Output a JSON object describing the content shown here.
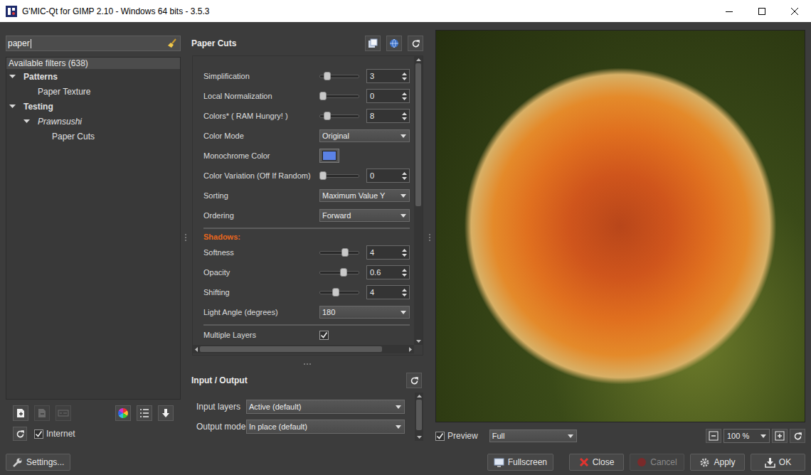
{
  "window": {
    "title": "G'MIC-Qt for GIMP 2.10 - Windows 64 bits - 3.5.3"
  },
  "search": {
    "value": "paper"
  },
  "filters": {
    "header": "Available filters (638)",
    "tree": [
      {
        "label": "Patterns",
        "kind": "category",
        "depth": 0,
        "expanded": true,
        "selected": false
      },
      {
        "label": "Paper Texture",
        "kind": "filter",
        "depth": 1,
        "expanded": false,
        "selected": false
      },
      {
        "label": "Testing",
        "kind": "category",
        "depth": 0,
        "expanded": true,
        "selected": false
      },
      {
        "label": "Prawnsushi",
        "kind": "subcategory",
        "depth": 1,
        "expanded": true,
        "selected": false
      },
      {
        "label": "Paper Cuts",
        "kind": "filter",
        "depth": 2,
        "expanded": false,
        "selected": false
      }
    ]
  },
  "filter_tools": [
    {
      "kind": "add-favorite",
      "disabled": false
    },
    {
      "kind": "remove-favorite",
      "disabled": true
    },
    {
      "kind": "rename-favorite",
      "disabled": true
    },
    {
      "kind": "colors",
      "disabled": false
    },
    {
      "kind": "list",
      "disabled": false
    },
    {
      "kind": "download",
      "disabled": false
    }
  ],
  "internet": {
    "label": "Internet",
    "checked": true
  },
  "filter": {
    "title": "Paper Cuts",
    "params": [
      {
        "kind": "slider",
        "label": "Simplification",
        "level": 0.12,
        "value": "3"
      },
      {
        "kind": "slider",
        "label": "Local Normalization",
        "level": 0,
        "value": "0"
      },
      {
        "kind": "slider",
        "label": "Colors* ( RAM Hungry! )",
        "level": 0.14,
        "value": "8"
      },
      {
        "kind": "dropdown",
        "label": "Color Mode",
        "value": "Original"
      },
      {
        "kind": "color",
        "label": "Monochrome Color",
        "color": "#5b82e6"
      },
      {
        "kind": "slider",
        "label": "Color Variation (Off If Random)",
        "level": 0,
        "value": "0"
      },
      {
        "kind": "dropdown",
        "label": "Sorting",
        "value": "Maximum Value Y"
      },
      {
        "kind": "dropdown",
        "label": "Ordering",
        "value": "Forward"
      },
      {
        "kind": "separator"
      },
      {
        "kind": "heading",
        "label": "Shadows:"
      },
      {
        "kind": "slider",
        "label": "Softness",
        "level": 0.67,
        "value": "4"
      },
      {
        "kind": "slider",
        "label": "Opacity",
        "level": 0.62,
        "value": "0.6"
      },
      {
        "kind": "slider",
        "label": "Shifting",
        "level": 0.4,
        "value": "4"
      },
      {
        "kind": "dropdown",
        "label": "Light Angle (degrees)",
        "value": "180"
      },
      {
        "kind": "separator"
      },
      {
        "kind": "checkbox",
        "label": "Multiple Layers",
        "checked": true
      }
    ],
    "scroll": {
      "vertical": {
        "level": 0.52
      },
      "horizontal": {
        "level": 0.88
      }
    }
  },
  "io": {
    "title": "Input / Output",
    "fields": [
      {
        "label": "Input layers",
        "value": "Active (default)"
      },
      {
        "label": "Output mode",
        "value": "In place (default)"
      }
    ],
    "scroll": {
      "level": 0.9
    }
  },
  "preview": {
    "label": "Preview",
    "checked": true,
    "mode": "Full",
    "zoom": "100 %"
  },
  "settings": {
    "label": "Settings..."
  },
  "buttons": [
    {
      "label": "Fullscreen",
      "kind": "fullscreen",
      "disabled": false
    },
    {
      "label": "Close",
      "kind": "close",
      "disabled": false
    },
    {
      "label": "Cancel",
      "kind": "cancel",
      "disabled": true
    },
    {
      "label": "Apply",
      "kind": "apply",
      "disabled": false
    },
    {
      "label": "OK",
      "kind": "ok",
      "disabled": false
    }
  ]
}
